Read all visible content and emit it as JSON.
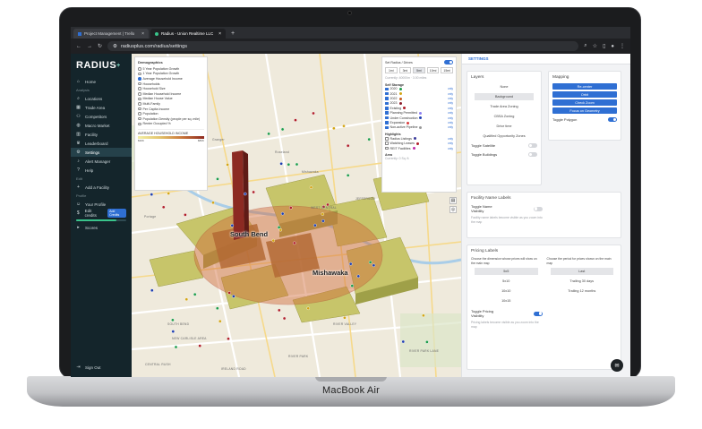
{
  "browser": {
    "tabs": [
      {
        "title": "Project Management | Trello",
        "active": false
      },
      {
        "title": "Radius - Union Realtime LLC",
        "active": true
      }
    ],
    "url": "radiusplus.com/radius/settings"
  },
  "device_label": "MacBook Air",
  "sidebar": {
    "logo": "RADIUS",
    "logo_mark": "+",
    "sections": {
      "analysis": "Analysis",
      "edit": "Edit",
      "profile": "Profile"
    },
    "items": [
      {
        "label": "Home",
        "icon": "home-icon"
      },
      {
        "label": "Locations",
        "icon": "search-icon"
      },
      {
        "label": "Trade Area",
        "icon": "map-icon"
      },
      {
        "label": "Competitors",
        "icon": "group-icon"
      },
      {
        "label": "Macro Market",
        "icon": "globe-icon"
      },
      {
        "label": "Facility",
        "icon": "building-icon"
      },
      {
        "label": "Leaderboard",
        "icon": "trophy-icon"
      },
      {
        "label": "Settings",
        "icon": "gear-icon"
      },
      {
        "label": "Alert Manager",
        "icon": "bell-icon"
      },
      {
        "label": "Help",
        "icon": "help-icon"
      }
    ],
    "edit_items": [
      {
        "label": "Add a Facility",
        "icon": "plus-icon"
      }
    ],
    "profile_items": [
      {
        "label": "Your Profile",
        "icon": "user-icon"
      },
      {
        "label": "Edit credits",
        "icon": "credit-icon"
      }
    ],
    "credits_badge": "Add Credits",
    "credits_text": "Scores",
    "credits_fill": 0.8,
    "sign_out": "Sign Out"
  },
  "demographics": {
    "title": "Demographics",
    "options": [
      "5 Year Population Growth",
      "1 Year Population Growth",
      "Average Household Income",
      "Households",
      "Household Size",
      "Median Household Income",
      "Median House Value",
      "Multi-Family",
      "Per Capita Income",
      "Population",
      "Population Density (people per sq. mile)",
      "Renter Occupied %"
    ],
    "selected_index": 2,
    "legend_title": "AVERAGE HOUSEHOLD INCOME",
    "legend_min": "$30K",
    "legend_max": "$80K"
  },
  "map_controls": {
    "radius_label": "Set Radius / Drives",
    "time_options": [
      "1mi",
      "3mi",
      "5mi",
      "10mi",
      "15mi"
    ],
    "time_selected": 2,
    "currently": "Currently: 40000m · 3.00 miles",
    "self_storage_title": "Self Storage",
    "years": [
      {
        "label": "2020",
        "color": "#1c9c4a"
      },
      {
        "label": "2021",
        "color": "#d3a516"
      },
      {
        "label": "2022",
        "color": "#c75b1c"
      },
      {
        "label": "2023",
        "color": "#8c1d2b"
      },
      {
        "label": "Existing",
        "color": "#b01f2a"
      },
      {
        "label": "Planning Permitted",
        "color": "#8d7ff2"
      },
      {
        "label": "Under Construction",
        "color": "#1f3fb0"
      },
      {
        "label": "Expansion",
        "color": "#d93e3e"
      },
      {
        "label": "Non-active Pipeline",
        "color": "#999999"
      }
    ],
    "only_label": "only",
    "highlights_title": "Highlights",
    "highlights": [
      {
        "label": "Radius Listings",
        "color": "#3c3c9c"
      },
      {
        "label": "Watching Leases",
        "color": "#b01f2a"
      },
      {
        "label": "REIT Facilities",
        "color": "#c229a8"
      }
    ],
    "area_title": "Area",
    "area_value": "Currently: 0 Sq. ft."
  },
  "map_labels": {
    "cities": [
      "South Bend",
      "Mishawaka"
    ],
    "roads": [
      "Granger",
      "Mishawaka",
      "Portage",
      "SOUTH BEND",
      "Roseland",
      "NEW CARLISLE AREA",
      "RIVER VALLEY",
      "JEFFERSON",
      "RIVER PARK",
      "IRELAND ROAD",
      "CENTRAL RUSH",
      "WEST CENTRAL",
      "RIVER PARK LANE"
    ]
  },
  "settings": {
    "header": "SETTINGS",
    "layers": {
      "title": "Layers",
      "options": [
        "None",
        "Background",
        "Trade Area Zoning",
        "CBSA Zoning",
        "Drive time",
        "Qualified Opportunity Zones"
      ],
      "selected_index": 1,
      "toggles": [
        {
          "label": "Toggle Satellite",
          "on": false
        },
        {
          "label": "Toggle Buildings",
          "on": false
        }
      ]
    },
    "mapping": {
      "title": "Mapping",
      "buttons": [
        "Re-center",
        "Orbit",
        "Check Zoom",
        "Focus on Geometry"
      ],
      "toggle_label": "Toggle Polygon",
      "toggle_on": true
    },
    "facility_labels": {
      "title": "Facility Name Labels",
      "toggle_label": "Toggle Name Visibility",
      "toggle_on": false,
      "hint": "Facility name labels become visible as you zoom into the map"
    },
    "pricing": {
      "title": "Pricing Labels",
      "dim_label": "Choose the dimension whose prices will show on the main map",
      "dims": [
        "5x5",
        "5x10",
        "10x10",
        "10x15"
      ],
      "dim_selected": 0,
      "period_label": "Choose the period for prices shown on the main map",
      "periods": [
        "Last",
        "Trailing 30 days",
        "Trailing 12 months"
      ],
      "period_selected": 0,
      "toggle_label": "Toggle Pricing Visibility",
      "toggle_on": true,
      "hint": "Pricing labels become visible as you zoom into the map"
    }
  }
}
